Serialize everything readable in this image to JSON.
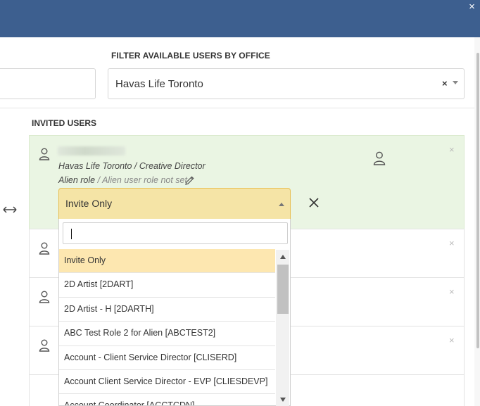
{
  "header": {
    "close_label": "×"
  },
  "filter": {
    "label": "FILTER AVAILABLE USERS BY OFFICE",
    "selected_office": "Havas Life Toronto",
    "clear_label": "×"
  },
  "invited": {
    "label": "INVITED USERS",
    "users": [
      {
        "office_role": "Havas Life Toronto / Creative Director",
        "alien_role_label": "Alien role",
        "alien_role_value": " / Alien user role not set",
        "remove_label": "×"
      },
      {
        "remove_label": "×"
      },
      {
        "remove_label": "×"
      },
      {
        "remove_label": "×"
      }
    ]
  },
  "role_picker": {
    "selected": "Invite Only",
    "search_value": "",
    "options": [
      "Invite Only",
      "2D Artist [2DART]",
      "2D Artist - H [2DARTH]",
      "ABC Test Role 2 for Alien [ABCTEST2]",
      "Account - Client Service Director [CLISERD]",
      "Account Client Service Director - EVP [CLIESDEVP]",
      "Account Coordinator [ACCTCDN]"
    ]
  },
  "colors": {
    "header_bg": "#3d5f8f",
    "active_card_bg": "#eaf5e3",
    "select_bg": "#f5e4a6",
    "select_border": "#e8bf55",
    "highlight_bg": "#fde7b0"
  },
  "icons": {
    "header_close": "close-icon",
    "user": "user-icon",
    "edit": "pencil-icon",
    "expand": "horizontal-arrows-icon",
    "cancel": "close-icon",
    "dropdown": "chevron-icon"
  }
}
